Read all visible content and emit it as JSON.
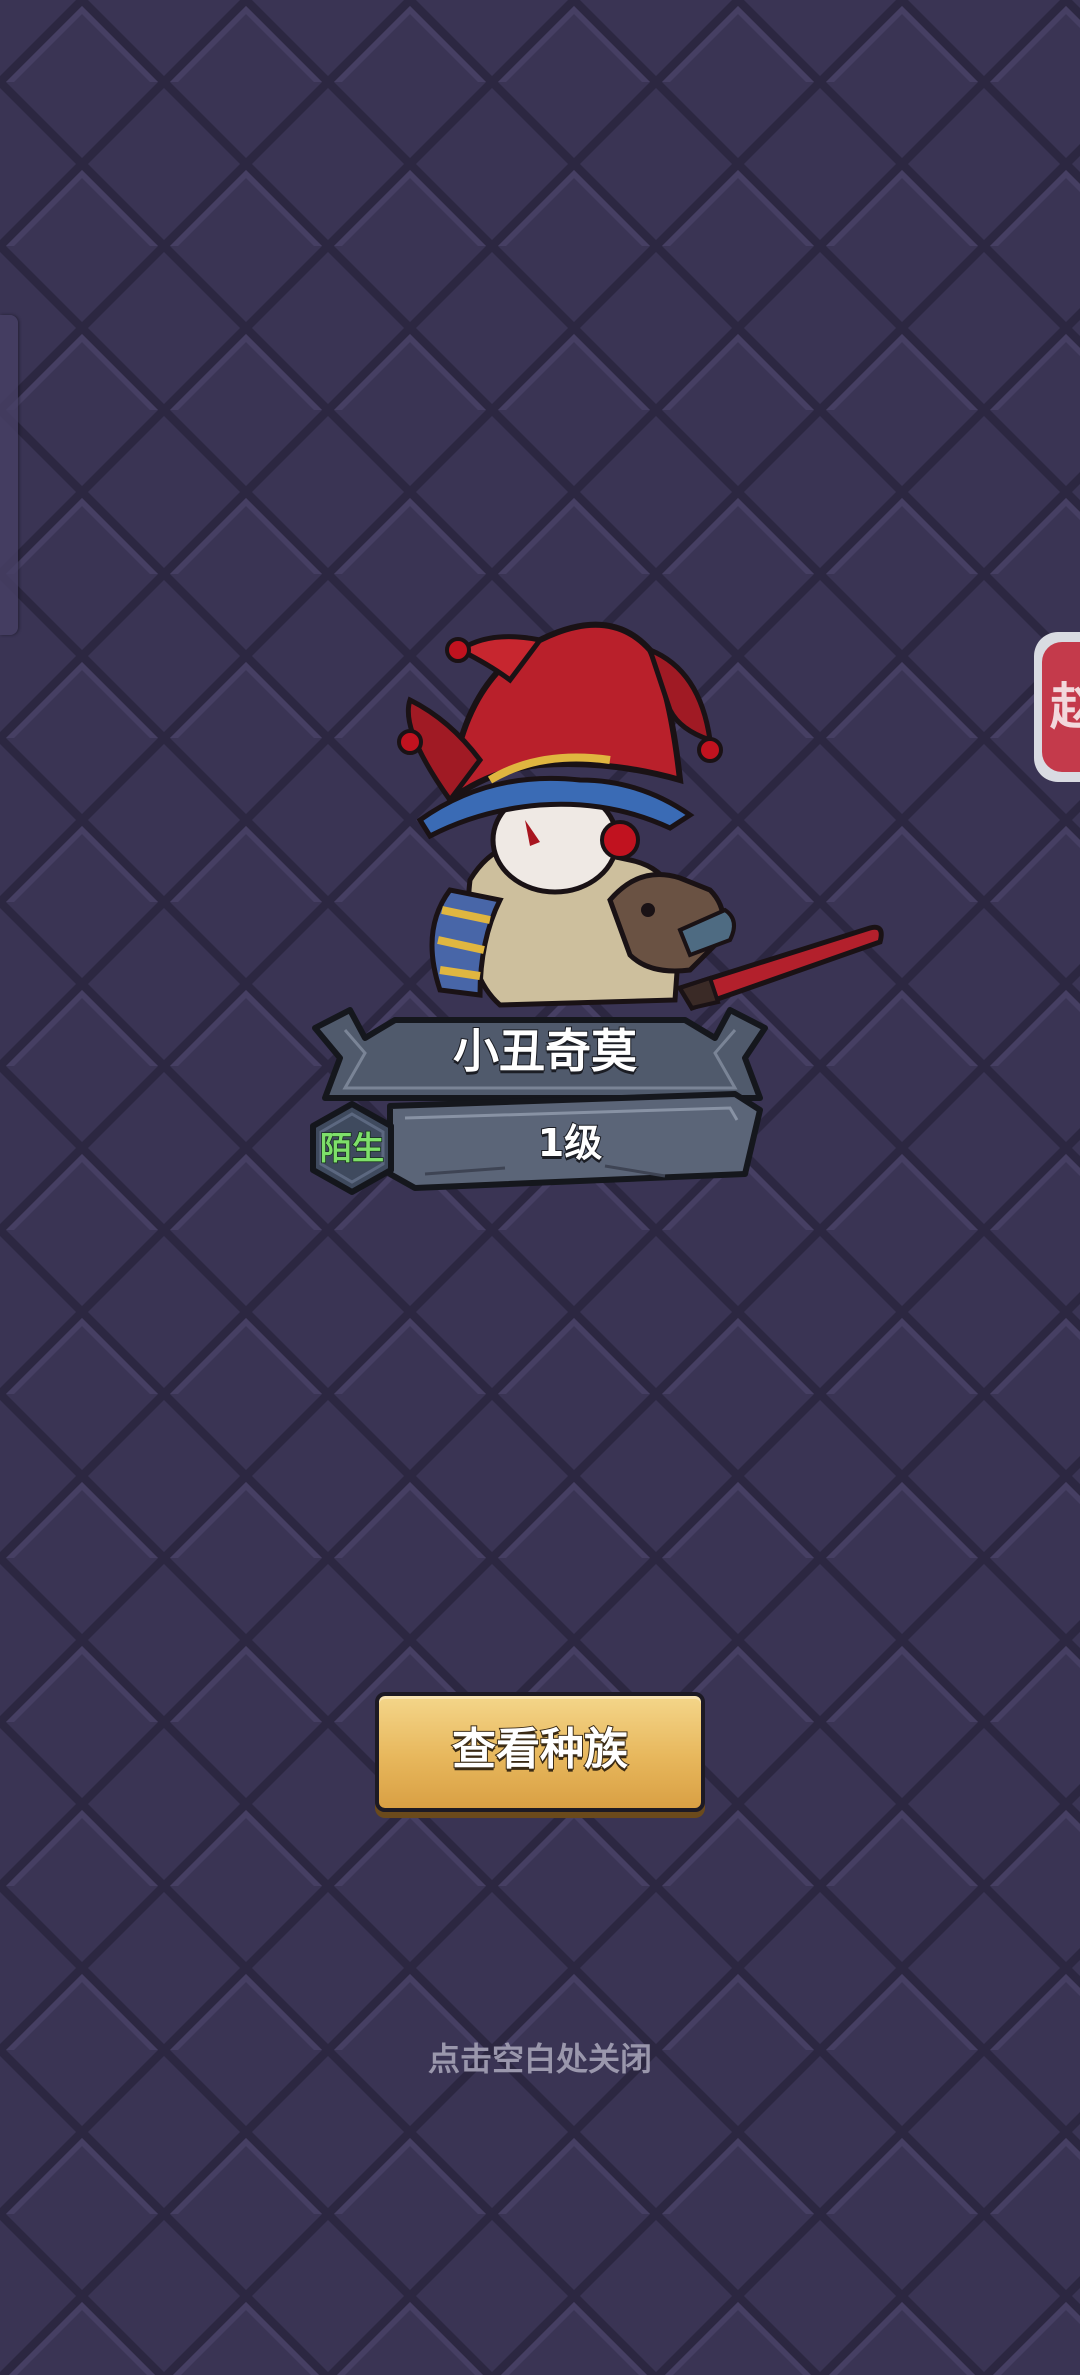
{
  "hero": {
    "name": "小丑奇莫",
    "level": "1级",
    "relation": "陌生"
  },
  "actions": {
    "view_race_label": "查看种族"
  },
  "hint": {
    "close_text": "点击空白处关闭"
  },
  "side_tab": {
    "right_label": "赵"
  },
  "colors": {
    "background": "#35304f",
    "tile_light": "#3d3757",
    "tile_dark": "#2e2944",
    "button_gold": "#e7b75c",
    "relation_green": "#7ee06a",
    "plaque_steel": "#5b6578"
  }
}
